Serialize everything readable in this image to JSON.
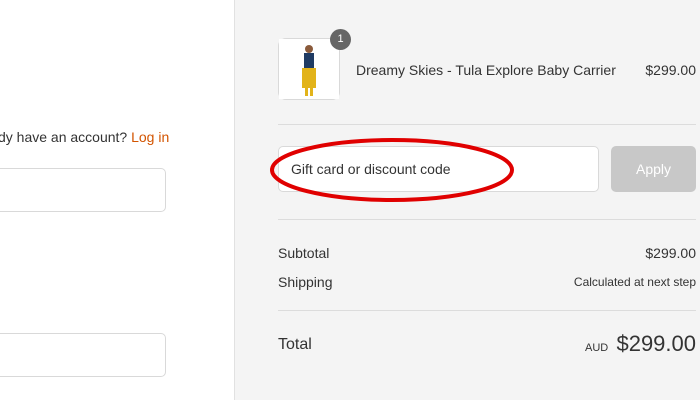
{
  "account": {
    "prompt": "dy have an account?",
    "login_label": "Log in"
  },
  "cart": {
    "quantity": "1",
    "product_name": "Dreamy Skies - Tula Explore Baby Carrier",
    "product_price": "$299.00"
  },
  "discount": {
    "placeholder": "Gift card or discount code",
    "apply_label": "Apply"
  },
  "summary": {
    "subtotal_label": "Subtotal",
    "subtotal_value": "$299.00",
    "shipping_label": "Shipping",
    "shipping_value": "Calculated at next step",
    "total_label": "Total",
    "currency": "AUD",
    "total_value": "$299.00"
  },
  "colors": {
    "link": "#d35400",
    "highlight": "#e00000",
    "apply_disabled": "#c8c8c8"
  }
}
